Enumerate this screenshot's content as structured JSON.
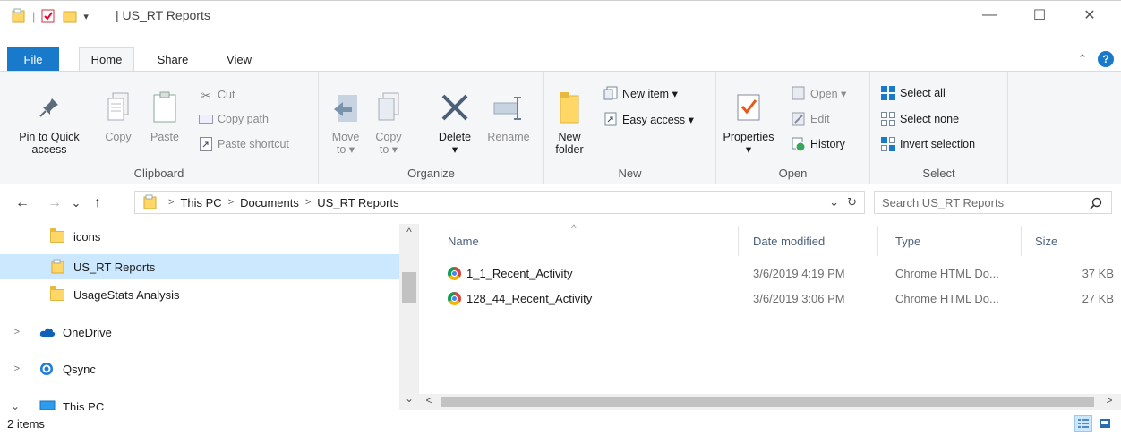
{
  "window": {
    "title": "US_RT Reports",
    "qat_separator": "|",
    "qat_dropdown": "▾",
    "minimize": "—",
    "maximize": "☐",
    "close": "✕"
  },
  "ribbon_tabs": {
    "file": "File",
    "home": "Home",
    "share": "Share",
    "view": "View",
    "collapse": "⌃",
    "help": "?"
  },
  "clipboard": {
    "label": "Clipboard",
    "pin_line1": "Pin to Quick",
    "pin_line2": "access",
    "copy": "Copy",
    "paste": "Paste",
    "cut": "Cut",
    "copy_path": "Copy path",
    "paste_shortcut": "Paste shortcut"
  },
  "organize": {
    "label": "Organize",
    "move_to": "Move",
    "move_to_2": "to ▾",
    "copy_to": "Copy",
    "copy_to_2": "to ▾",
    "delete": "Delete",
    "delete_2": "▾",
    "rename": "Rename"
  },
  "new_group": {
    "label": "New",
    "new_folder": "New",
    "new_folder_2": "folder",
    "new_item": "New item ▾",
    "easy_access": "Easy access ▾"
  },
  "open_group": {
    "label": "Open",
    "properties": "Properties",
    "properties_2": "▾",
    "open": "Open ▾",
    "edit": "Edit",
    "history": "History"
  },
  "select_group": {
    "label": "Select",
    "select_all": "Select all",
    "select_none": "Select none",
    "invert_selection": "Invert selection"
  },
  "nav": {
    "back": "←",
    "forward": "→",
    "recent": "⌄",
    "up": "↑",
    "breadcrumb": [
      "This PC",
      "Documents",
      "US_RT Reports"
    ],
    "crumb_sep": ">",
    "dropdown": "⌄",
    "refresh": "↻",
    "search_placeholder": "Search US_RT Reports"
  },
  "nav_pane": {
    "items": [
      {
        "label": "icons",
        "type": "folder"
      },
      {
        "label": "US_RT Reports",
        "type": "folder"
      },
      {
        "label": "UsageStats Analysis",
        "type": "folder"
      },
      {
        "label": "OneDrive",
        "type": "onedrive"
      },
      {
        "label": "Qsync",
        "type": "qsync"
      },
      {
        "label": "This PC",
        "type": "pc"
      }
    ],
    "expand": ">",
    "collapse": "⌄"
  },
  "columns": {
    "name": "Name",
    "date_modified": "Date modified",
    "type": "Type",
    "size": "Size",
    "sort_indicator": "^"
  },
  "files": [
    {
      "name": "1_1_Recent_Activity",
      "date": "3/6/2019 4:19 PM",
      "type": "Chrome HTML Do...",
      "size": "37 KB"
    },
    {
      "name": "128_44_Recent_Activity",
      "date": "3/6/2019 3:06 PM",
      "type": "Chrome HTML Do...",
      "size": "27 KB"
    }
  ],
  "scroll": {
    "up": "^",
    "down": "⌄",
    "left": "<",
    "right": ">"
  },
  "status": {
    "item_count": "2 items"
  },
  "colors": {
    "file_tab": "#1979ca",
    "selection": "#cce8ff",
    "folder": "#ffd767",
    "header_text": "#4c607a"
  }
}
